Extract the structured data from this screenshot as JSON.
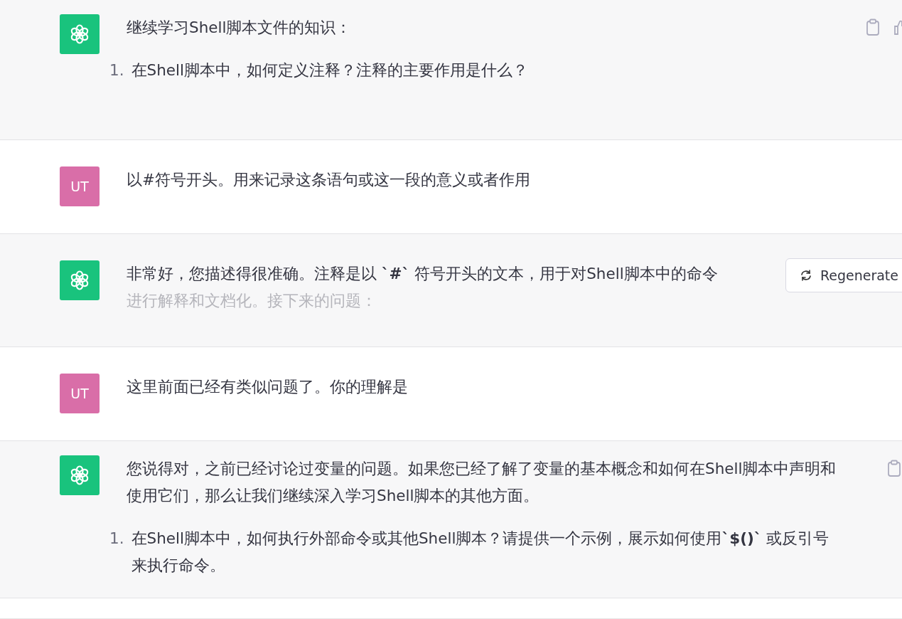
{
  "messages": [
    {
      "kind": "assistant",
      "paragraphs": [
        "继续学习Shell脚本文件的知识："
      ],
      "list": [
        {
          "number": "1.",
          "text": "在Shell脚本中，如何定义注释？注释的主要作用是什么？"
        }
      ],
      "actions": [
        {
          "kind": "copy"
        },
        {
          "kind": "thumb"
        }
      ]
    },
    {
      "kind": "user",
      "avatar": "UT",
      "paragraphs": [
        "以#符号开头。用来记录这条语句或这一段的意义或者作用"
      ]
    },
    {
      "kind": "assistant",
      "paragraphs": [
        "非常好，您描述得很准确。注释是以 **`#`** 符号开头的文本，用于对Shell脚本中的命令"
      ],
      "faded_line": "进行解释和文档化。接下来的问题：",
      "regenerate": {
        "label": "Regenerate"
      }
    },
    {
      "kind": "user",
      "avatar": "UT",
      "paragraphs": [
        "这里前面已经有类似问题了。你的理解是"
      ]
    },
    {
      "kind": "assistant",
      "paragraphs": [
        "您说得对，之前已经讨论过变量的问题。如果您已经了解了变量的基本概念和如何在Shell脚本中声明和使用它们，那么让我们继续深入学习Shell脚本的其他方面。"
      ],
      "list": [
        {
          "number": "1.",
          "text": "在Shell脚本中，如何执行外部命令或其他Shell脚本？请提供一个示例，展示如何使用**`$()`** 或反引号来执行命令。"
        }
      ],
      "actions": [
        {
          "kind": "copy"
        }
      ]
    }
  ]
}
